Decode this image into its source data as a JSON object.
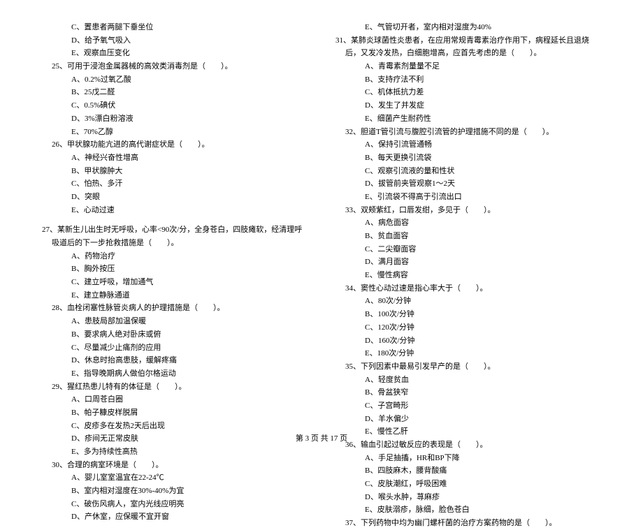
{
  "left": {
    "opts_pre": [
      "C、置患者两腿下垂坐位",
      "D、给予氧气吸入",
      "E、观察血压变化"
    ],
    "q25": "25、可用于浸泡金属器械的高效类消毒剂是（　　）。",
    "q25_opts": [
      "A、0.2%过氧乙酸",
      "B、25戊二醛",
      "C、0.5%碘伏",
      "D、3%漂白粉溶液",
      "E、70%乙醇"
    ],
    "q26": "26、甲状腺功能亢进的高代谢症状是（　　）。",
    "q26_opts": [
      "A、神经兴奋性增高",
      "B、甲状腺肿大",
      "C、怕热、多汗",
      "D、突眼",
      "E、心动过速"
    ],
    "q27": "27、某新生儿出生时无呼吸，心率<90次/分，全身苍白，四肢瘫软，经清理呼吸道后的下一步抢救措施是（　　）。",
    "q27_opts": [
      "A、药物治疗",
      "B、胸外按压",
      "C、建立呼吸，增加通气",
      "E、建立静脉通道"
    ],
    "q28": "28、血栓闭塞性脉管炎病人的护理措施是（　　）。",
    "q28_opts": [
      "A、患肢局部加温保暖",
      "B、要求病人绝对卧床或俯",
      "C、尽量减少止痛剂的应用",
      "D、休息时抬高患肢，缓解疼痛",
      "E、指导晚期病人做伯尔格运动"
    ],
    "q29": "29、猩红热患儿特有的体征是（　　）。",
    "q29_opts": [
      "A、口周苍白圈",
      "B、帕子糠皮样脱屑",
      "C、皮疹多在发热2天后出现",
      "D、疹间无正常皮肤",
      "E、多为持续性高热"
    ],
    "q30": "30、合理的病室环境是（　　）。",
    "q30_opts": [
      "A、婴儿室室温宜在22-24℃",
      "B、室内相对湿度在30%-40%为宜",
      "C、破伤风病人，室内光线应明亮",
      "D、产休室，应保暖不宜开窗"
    ]
  },
  "right": {
    "opts_pre": [
      "E、气管切开者，室内相对湿度为40%"
    ],
    "q31": "31、某肺炎球菌性炎患者，在应用常规青霉素治疗作用下，病程延长且退烧后，又发冷发热，白细胞增高，应首先考虑的是（　　）。",
    "q31_opts": [
      "A、青霉素剂量量不足",
      "B、支持疗法不利",
      "C、机体抵抗力差",
      "D、发生了并发症",
      "E、细菌产生耐药性"
    ],
    "q32": "32、胆道T管引流与腹腔引流管的护理措施不同的是（　　）。",
    "q32_opts": [
      "A、保持引流管通畅",
      "B、每天更换引流袋",
      "C、观察引流液的量和性状",
      "D、拔管前夹管观察1～2天",
      "E、引流袋不得高于引流出口"
    ],
    "q33": "33、双颊紫红，口唇发绀，多见于（　　）。",
    "q33_opts": [
      "A、病危面容",
      "B、贫血面容",
      "C、二尖瓣面容",
      "D、满月面容",
      "E、慢性病容"
    ],
    "q34": "34、窦性心动过速是指心率大于（　　）。",
    "q34_opts": [
      "A、80次/分钟",
      "B、100次/分钟",
      "C、120次/分钟",
      "D、160次/分钟",
      "E、180次/分钟"
    ],
    "q35": "35、下列因素中最易引发早产的是（　　）。",
    "q35_opts": [
      "A、轻度贫血",
      "B、骨盆狭窄",
      "C、子宫畸形",
      "D、羊水偏少",
      "E、慢性乙肝"
    ],
    "q36": "36、输血引起过敏反应的表现是（　　）。",
    "q36_opts": [
      "A、手足抽搐，HR和BP下降",
      "B、四肢麻木，腰背酸痛",
      "C、皮肤潮红，呼吸困难",
      "D、喉头水肿，荨麻疹",
      "E、皮肤溺疹，脉细，脸色苍白"
    ],
    "q37": "37、下列药物中均为幽门螺杆菌的治疗方案药物的是（　　）。"
  },
  "footer": "第 3 页 共 17 页"
}
